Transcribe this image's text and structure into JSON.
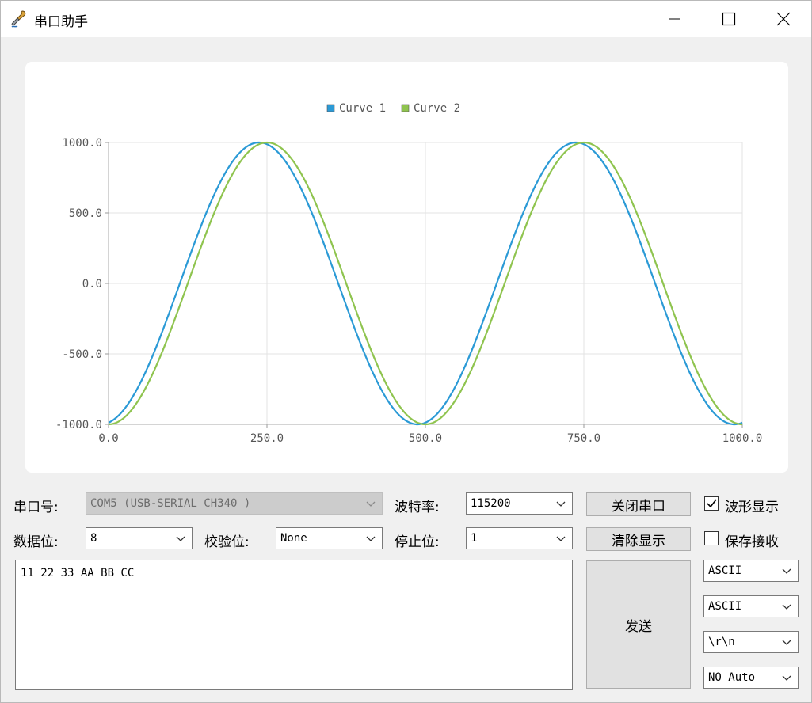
{
  "window": {
    "title": "串口助手"
  },
  "chart_data": {
    "type": "line",
    "legend": [
      "Curve 1",
      "Curve 2"
    ],
    "legend_position": "top",
    "grid": true,
    "xlim": [
      0,
      1000
    ],
    "ylim": [
      -1000,
      1000
    ],
    "x_ticks": [
      "0.0",
      "250.0",
      "500.0",
      "750.0",
      "1000.0"
    ],
    "y_ticks": [
      "1000.0",
      "500.0",
      "0.0",
      "-500.0",
      "-1000.0"
    ],
    "colors": {
      "Curve 1": "#2b9ad6",
      "Curve 2": "#8fc44f"
    },
    "series": [
      {
        "name": "Curve 1",
        "amplitude": 1000,
        "period": 500,
        "phase": -0.225,
        "x_start": 0,
        "x_end": 1000
      },
      {
        "name": "Curve 2",
        "amplitude": 1000,
        "period": 500,
        "phase": -0.25,
        "x_start": 0,
        "x_end": 1000
      }
    ]
  },
  "serial": {
    "port_label": "串口号:",
    "port_value": "COM5 (USB-SERIAL CH340 )",
    "baud_label": "波特率:",
    "baud_value": "115200",
    "close_port_button": "关闭串口",
    "waveform_display_label": "波形显示",
    "waveform_display_checked": true,
    "data_bits_label": "数据位:",
    "data_bits_value": "8",
    "parity_label": "校验位:",
    "parity_value": "None",
    "stop_bits_label": "停止位:",
    "stop_bits_value": "1",
    "clear_display_button": "清除显示",
    "save_receive_label": "保存接收",
    "save_receive_checked": false,
    "send_text": "11 22 33 AA BB CC",
    "send_button": "发送",
    "receive_format": "ASCII",
    "send_format": "ASCII",
    "line_ending": "\\r\\n",
    "auto_send": "NO Auto"
  }
}
